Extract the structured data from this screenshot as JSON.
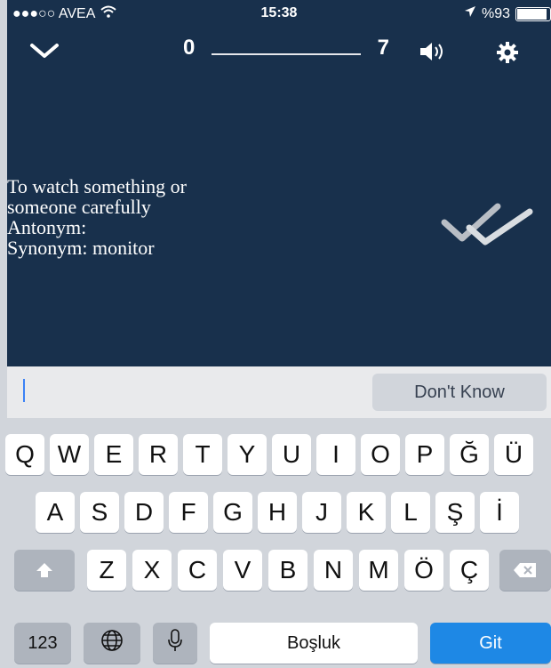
{
  "status_bar": {
    "carrier": "●●●○○ AVEA",
    "time": "15:38",
    "battery": "%93",
    "battery_level": 0.93
  },
  "toolbar": {
    "progress_start": "0",
    "progress_end": "7"
  },
  "card": {
    "definition_lines": [
      "To watch something or",
      "someone carefully",
      "Antonym:",
      "Synonym: monitor"
    ]
  },
  "input": {
    "dont_know_label": "Don't Know"
  },
  "keyboard": {
    "row1": [
      "Q",
      "W",
      "E",
      "R",
      "T",
      "Y",
      "U",
      "I",
      "O",
      "P",
      "Ğ",
      "Ü"
    ],
    "row2": [
      "A",
      "S",
      "D",
      "F",
      "G",
      "H",
      "J",
      "K",
      "L",
      "Ş",
      "İ"
    ],
    "row3": [
      "Z",
      "X",
      "C",
      "V",
      "B",
      "N",
      "M",
      "Ö",
      "Ç"
    ],
    "numbers_label": "123",
    "space_label": "Boşluk",
    "go_label": "Git"
  },
  "colors": {
    "background": "#18304c",
    "go_key": "#1e88e5",
    "caret": "#3b82f6"
  }
}
